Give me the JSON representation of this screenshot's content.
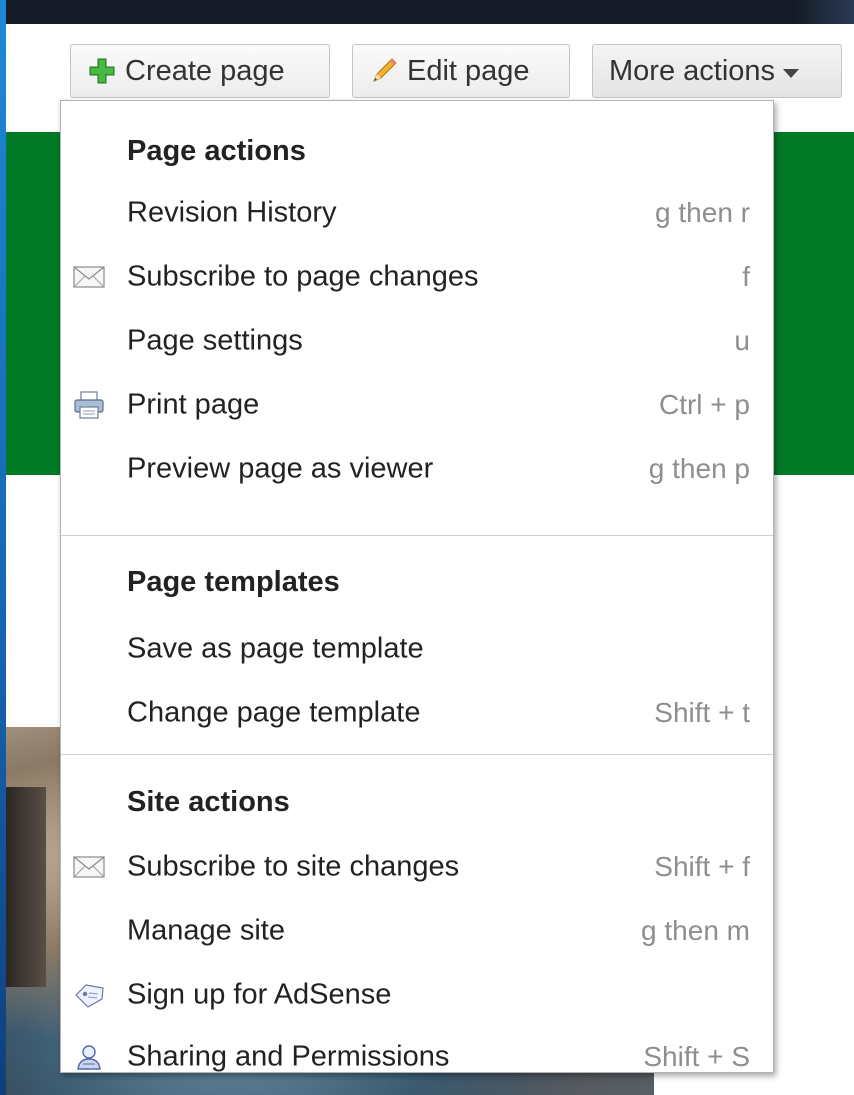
{
  "toolbar": {
    "create_label": "Create page",
    "edit_label": "Edit page",
    "more_label": "More actions"
  },
  "menu": {
    "page_actions": {
      "title": "Page actions",
      "items": [
        {
          "label": "Revision History",
          "shortcut": "g then r",
          "icon": ""
        },
        {
          "label": "Subscribe to page changes",
          "shortcut": "f",
          "icon": "envelope-icon"
        },
        {
          "label": "Page settings",
          "shortcut": "u",
          "icon": ""
        },
        {
          "label": "Print page",
          "shortcut": "Ctrl + p",
          "icon": "printer-icon"
        },
        {
          "label": "Preview page as viewer",
          "shortcut": "g then p",
          "icon": ""
        }
      ]
    },
    "page_templates": {
      "title": "Page templates",
      "items": [
        {
          "label": "Save as page template",
          "shortcut": "",
          "icon": ""
        },
        {
          "label": "Change page template",
          "shortcut": "Shift + t",
          "icon": ""
        }
      ]
    },
    "site_actions": {
      "title": "Site actions",
      "items": [
        {
          "label": "Subscribe to site changes",
          "shortcut": "Shift + f",
          "icon": "envelope-icon"
        },
        {
          "label": "Manage site",
          "shortcut": "g then m",
          "icon": ""
        },
        {
          "label": "Sign up for AdSense",
          "shortcut": "",
          "icon": "adsense-tag-icon"
        },
        {
          "label": "Sharing and Permissions",
          "shortcut": "Shift + S",
          "icon": "user-share-icon"
        }
      ]
    }
  },
  "colors": {
    "green_band": "#007a25",
    "frame_blue": "#1e88d8",
    "shortcut_gray": "#8e8e8e"
  }
}
